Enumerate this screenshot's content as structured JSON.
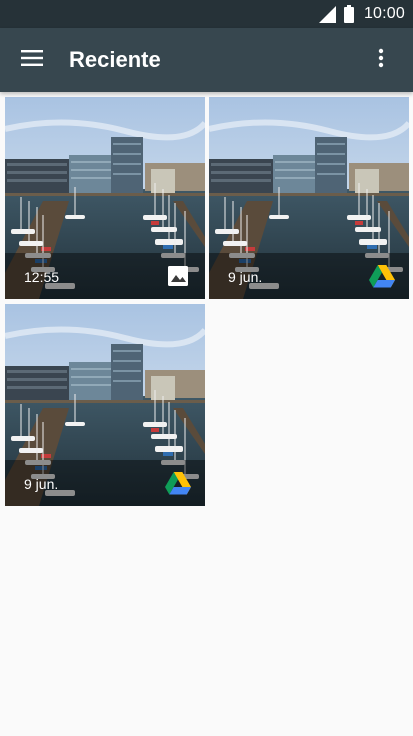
{
  "status_bar": {
    "time": "10:00",
    "icons": [
      "signal-icon",
      "battery-icon"
    ]
  },
  "app_bar": {
    "menu_icon": "hamburger-menu-icon",
    "title": "Reciente",
    "overflow_icon": "more-vert-icon"
  },
  "colors": {
    "status_bar": "#263238",
    "app_bar": "#37474F",
    "background": "#FAFAFA"
  },
  "photos": [
    {
      "label": "12:55",
      "source_icon": "image-icon"
    },
    {
      "label": "9 jun.",
      "source_icon": "google-drive-icon"
    },
    {
      "label": "9 jun.",
      "source_icon": "google-drive-icon"
    }
  ]
}
